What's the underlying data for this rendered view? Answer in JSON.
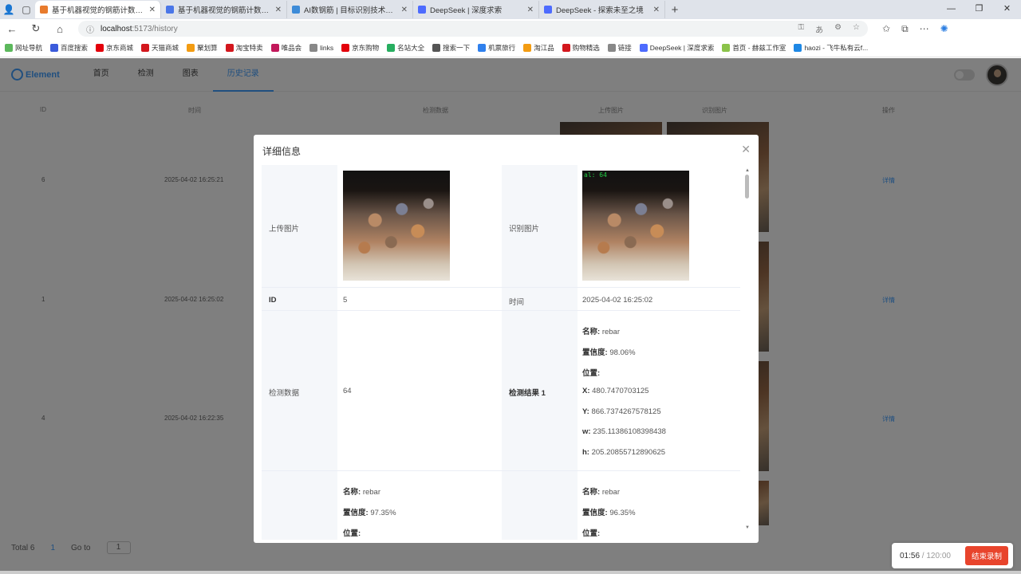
{
  "browser": {
    "tabs": [
      {
        "title": "基于机器视觉的钢筋计数系统算...",
        "color": "#e87b2d",
        "active": true
      },
      {
        "title": "基于机器视觉的钢筋计数系统算...",
        "color": "#4a76e8",
        "active": false
      },
      {
        "title": "AI数钢筋 | 目标识别技术在钢筋...",
        "color": "#3d8bd8",
        "active": false
      },
      {
        "title": "DeepSeek | 深度求索",
        "color": "#4d6bfe",
        "active": false
      },
      {
        "title": "DeepSeek - 探索未至之境",
        "color": "#4d6bfe",
        "active": false
      }
    ],
    "url_host": "localhost",
    "url_path": ":5173/history",
    "bookmarks": [
      {
        "label": "网址导航",
        "color": "#5cb85c"
      },
      {
        "label": "百度搜索",
        "color": "#3b5bdb"
      },
      {
        "label": "京东商城",
        "color": "#e3000b"
      },
      {
        "label": "天猫商城",
        "color": "#d3171d"
      },
      {
        "label": "聚划算",
        "color": "#f39c12"
      },
      {
        "label": "淘宝特卖",
        "color": "#d3171d"
      },
      {
        "label": "唯品会",
        "color": "#c2185b"
      },
      {
        "label": "links",
        "color": "#888"
      },
      {
        "label": "京东购物",
        "color": "#e3000b"
      },
      {
        "label": "名站大全",
        "color": "#27ae60"
      },
      {
        "label": "搜索一下",
        "color": "#555"
      },
      {
        "label": "机票旅行",
        "color": "#2f80ed"
      },
      {
        "label": "淘江品",
        "color": "#f39c12"
      },
      {
        "label": "购物精选",
        "color": "#d3171d"
      },
      {
        "label": "链接",
        "color": "#888"
      },
      {
        "label": "DeepSeek | 深度求索",
        "color": "#4d6bfe"
      },
      {
        "label": "首页 - 赫兹工作室",
        "color": "#8bc34a"
      },
      {
        "label": "haozi - 飞牛私有云f...",
        "color": "#1e88e5"
      }
    ]
  },
  "app": {
    "logo": "Element",
    "menu": [
      {
        "label": "首页",
        "active": false
      },
      {
        "label": "检测",
        "active": false
      },
      {
        "label": "图表",
        "active": false
      },
      {
        "label": "历史记录",
        "active": true
      }
    ],
    "table": {
      "headers": [
        "ID",
        "时间",
        "检测数据",
        "上传图片",
        "识别图片",
        "操作"
      ],
      "rows": [
        {
          "id": "6",
          "time": "2025-04-02 16:25:21",
          "action": "详情"
        },
        {
          "id": "1",
          "time": "2025-04-02 16:25:02",
          "action": "详情"
        },
        {
          "id": "4",
          "time": "2025-04-02 16:22:35",
          "action": "详情"
        }
      ]
    },
    "pager": {
      "total": "Total 6",
      "page": "1",
      "goto": "Go to",
      "goto_value": "1"
    }
  },
  "dialog": {
    "title": "详细信息",
    "labels": {
      "upload": "上传图片",
      "recognized": "识别图片",
      "id": "ID",
      "time": "时间",
      "detect_data": "检测数据",
      "result1": "检测结果 1"
    },
    "id_value": "5",
    "time_value": "2025-04-02 16:25:02",
    "detect_count": "64",
    "recognized_overlay": "al: 64",
    "result1": {
      "name_label": "名称:",
      "name": "rebar",
      "conf_label": "置信度:",
      "conf": "98.06%",
      "pos_label": "位置:",
      "x_label": "X:",
      "x": "480.7470703125",
      "y_label": "Y:",
      "y": "866.7374267578125",
      "w_label": "w:",
      "w": "235.11386108398438",
      "h_label": "h:",
      "h": "205.20855712890625"
    },
    "result_left": {
      "name_label": "名称:",
      "name": "rebar",
      "conf_label": "置信度:",
      "conf": "97.35%",
      "pos_label": "位置:"
    },
    "result_right": {
      "name_label": "名称:",
      "name": "rebar",
      "conf_label": "置信度:",
      "conf": "96.35%",
      "pos_label": "位置:"
    }
  },
  "recorder": {
    "elapsed": "01:56",
    "separator": " / ",
    "total": "120:00",
    "stop": "结束录制"
  }
}
